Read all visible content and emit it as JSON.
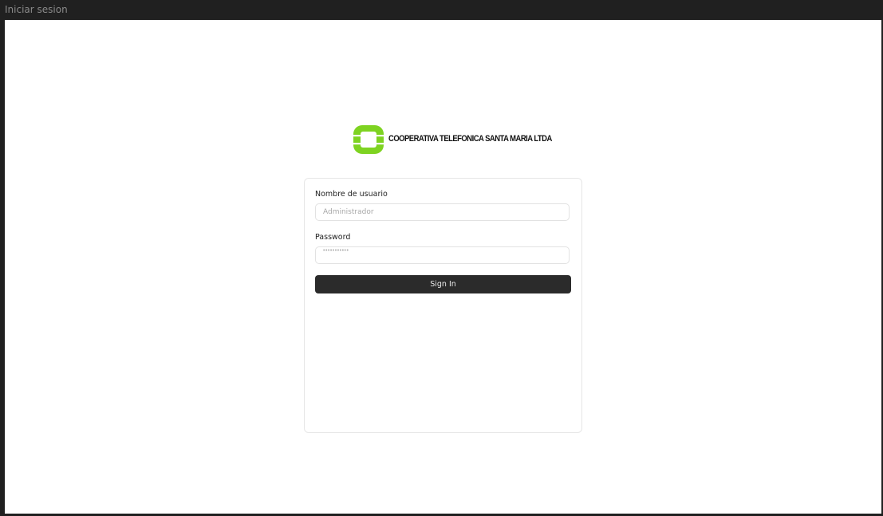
{
  "window": {
    "title": "Iniciar sesion"
  },
  "logo": {
    "text": "COOPERATIVA TELEFONICA SANTA MARIA LTDA",
    "color": "#7ed321"
  },
  "form": {
    "username_label": "Nombre de usuario",
    "username_placeholder": "Administrador",
    "password_label": "Password",
    "password_mask": "•••••••••••",
    "submit_label": "Sign In"
  },
  "colors": {
    "titlebar": "#202020",
    "button": "#2b2b2b",
    "background": "#ffffff"
  }
}
